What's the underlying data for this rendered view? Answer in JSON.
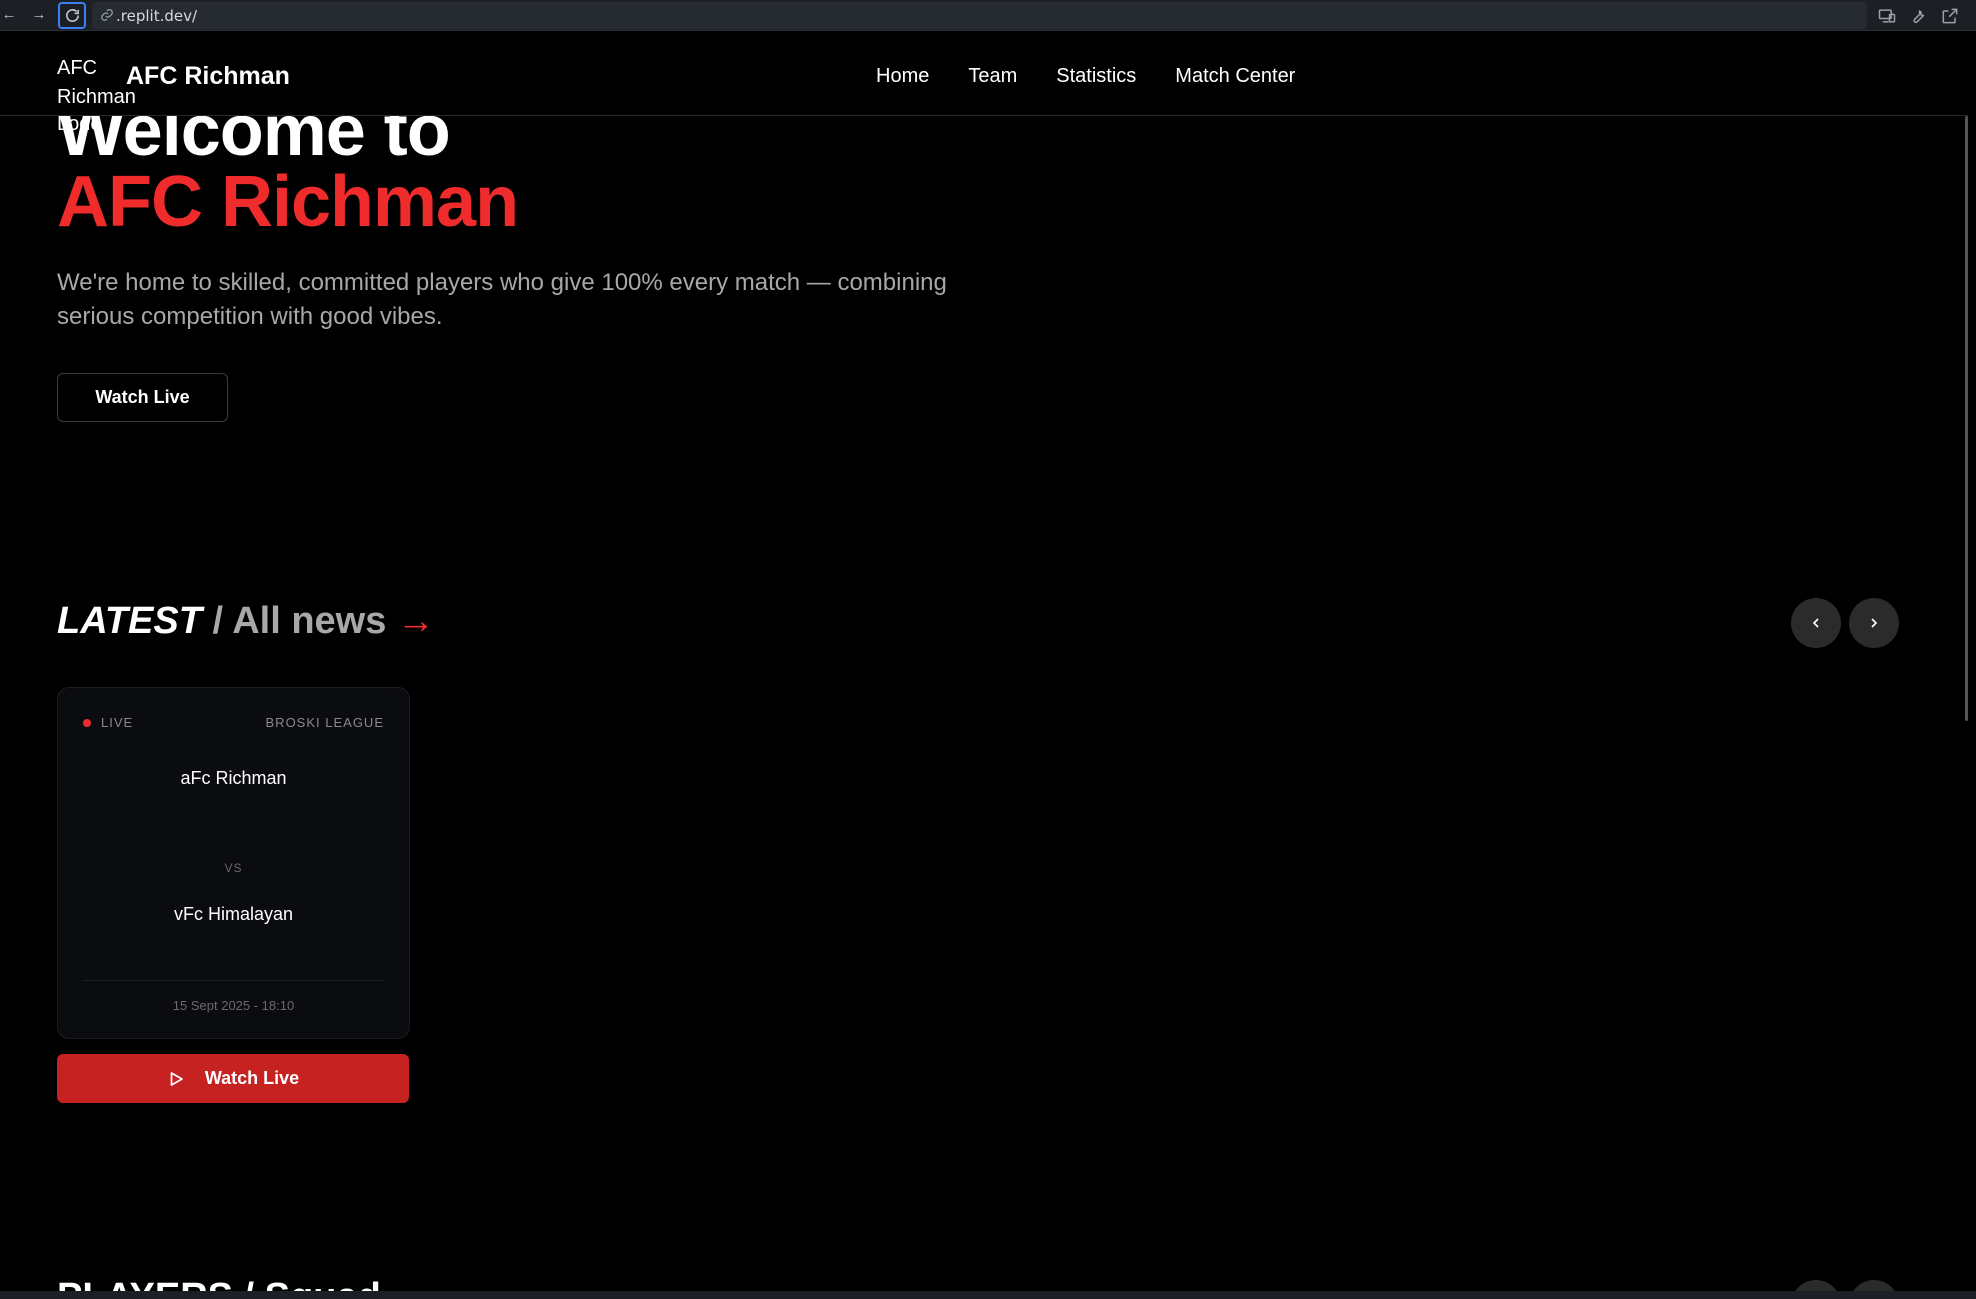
{
  "browser": {
    "url": ".replit.dev/"
  },
  "header": {
    "logo_alt": [
      "AFC",
      "Richman",
      "Logo"
    ],
    "brand": "AFC Richman",
    "nav": [
      "Home",
      "Team",
      "Statistics",
      "Match Center"
    ]
  },
  "hero": {
    "title_line1": "Welcome to",
    "title_line2": "AFC Richman",
    "subtitle": "We're home to skilled, committed players who give 100% every match — combining serious competition with good vibes.",
    "cta": "Watch Live"
  },
  "latest": {
    "label": "LATEST",
    "separator": " / ",
    "all_news": "All news",
    "arrow": " →"
  },
  "match": {
    "status": "LIVE",
    "league": "BROSKI LEAGUE",
    "home_team": "aFc Richman",
    "vs": "VS",
    "away_team": "vFc Himalayan",
    "datetime": "15 Sept 2025 - 18:10",
    "watch_label": "Watch Live"
  },
  "next_section": {
    "heading_partial": "PLAYERS / Squad"
  },
  "colors": {
    "accent": "#ef2b2b",
    "button_red": "#c62222",
    "background": "#000000"
  }
}
